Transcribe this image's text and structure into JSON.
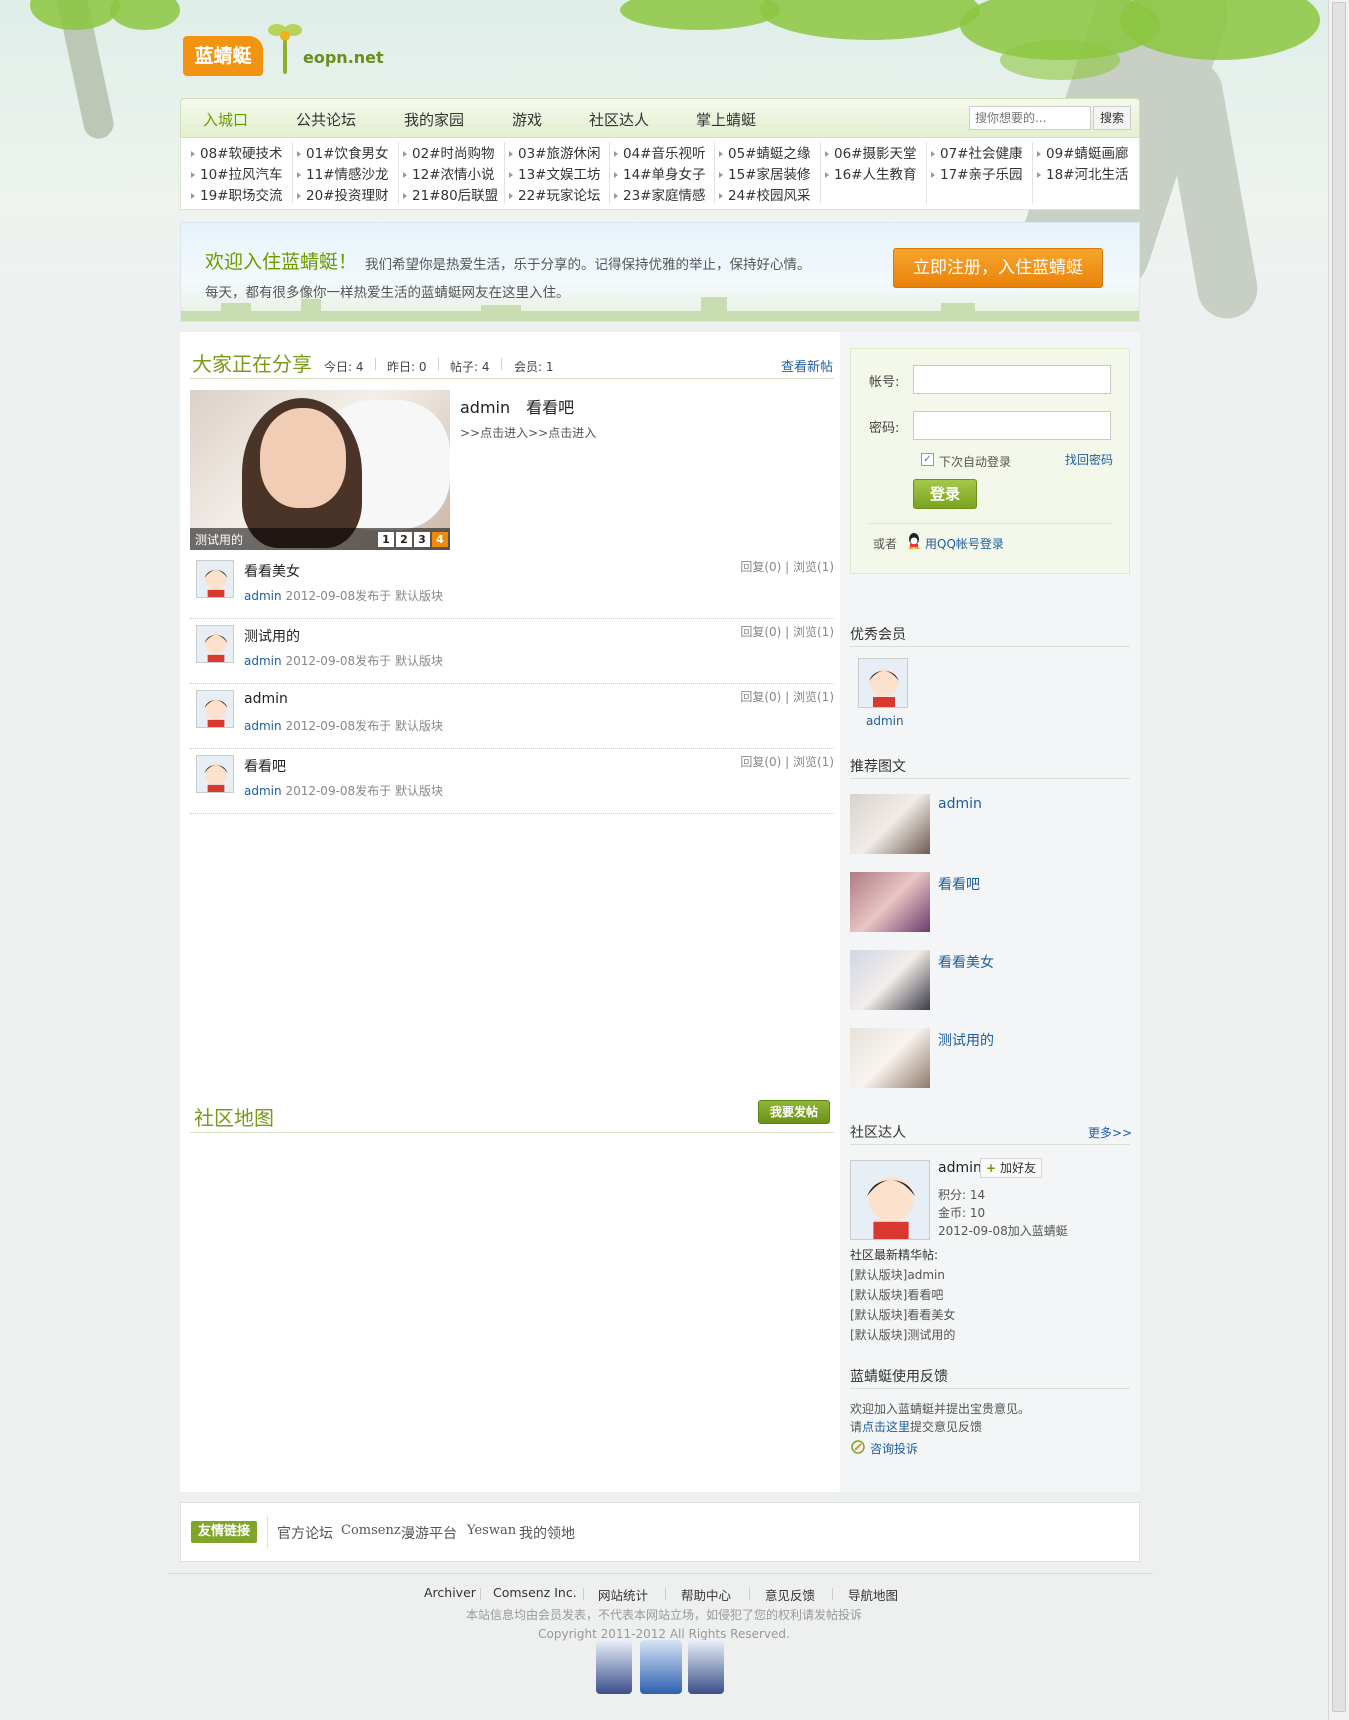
{
  "logo": {
    "brand": "蓝蜻蜓",
    "domain": "eopn.net"
  },
  "nav": {
    "items": [
      "入城口",
      "公共论坛",
      "我的家园",
      "游戏",
      "社区达人",
      "掌上蜻蜓"
    ],
    "search_placeholder": "搜你想要的...",
    "search_button": "搜索"
  },
  "forums": [
    [
      "08#软硬技术",
      "01#饮食男女",
      "02#时尚购物",
      "03#旅游休闲",
      "04#音乐视听",
      "05#蜻蜓之缘",
      "06#摄影天堂",
      "07#社会健康",
      "09#蜻蜓画廊"
    ],
    [
      "10#拉风汽车",
      "11#情感沙龙",
      "12#浓情小说",
      "13#文娱工坊",
      "14#单身女子",
      "15#家居装修",
      "16#人生教育",
      "17#亲子乐园",
      "18#河北生活"
    ],
    [
      "19#职场交流",
      "20#投资理财",
      "21#80后联盟",
      "22#玩家论坛",
      "23#家庭情感",
      "24#校园风采"
    ]
  ],
  "welcome": {
    "title": "欢迎入住蓝蜻蜓！",
    "desc1": "我们希望你是热爱生活，乐于分享的。记得保持优雅的举止，保持好心情。",
    "desc2": "每天，都有很多像你一样热爱生活的蓝蜻蜓网友在这里入住。",
    "register": "立即注册，入住蓝蜻蜓"
  },
  "sharing": {
    "title": "大家正在分享",
    "stats": [
      "今日: 4",
      "昨日: 0",
      "帖子: 4",
      "会员: 1"
    ],
    "new_link": "查看新帖",
    "slide_caption": "测试用的",
    "slide_numbers": [
      "1",
      "2",
      "3",
      "4"
    ],
    "featured_title": "admin　看看吧",
    "featured_sub": ">>点击进入>>点击进入"
  },
  "threads": [
    {
      "title": "看看美女",
      "author": "admin",
      "meta": "2012-09-08发布于 默认版块",
      "stats": "回复(0) | 浏览(1)"
    },
    {
      "title": "测试用的",
      "author": "admin",
      "meta": "2012-09-08发布于 默认版块",
      "stats": "回复(0) | 浏览(1)"
    },
    {
      "title": "admin",
      "author": "admin",
      "meta": "2012-09-08发布于 默认版块",
      "stats": "回复(0) | 浏览(1)"
    },
    {
      "title": "看看吧",
      "author": "admin",
      "meta": "2012-09-08发布于 默认版块",
      "stats": "回复(0) | 浏览(1)"
    }
  ],
  "map": {
    "title": "社区地图",
    "post_button": "我要发帖"
  },
  "login": {
    "account_label": "帐号:",
    "password_label": "密码:",
    "remember": "下次自动登录",
    "forgot": "找回密码",
    "submit": "登录",
    "or": "或者",
    "qq_login": "用QQ帐号登录"
  },
  "sidebar": {
    "members_title": "优秀会员",
    "member_name": "admin",
    "pics_title": "推荐图文",
    "pics": [
      "admin",
      "看看吧",
      "看看美女",
      "测试用的"
    ],
    "experts_title": "社区达人",
    "experts_more": "更多>>",
    "expert": {
      "name": "admin",
      "add_friend": "加好友",
      "points": "积分: 14",
      "coins": "金币: 10",
      "joined": "2012-09-08加入蓝蜻蜓"
    },
    "elite_title": "社区最新精华帖:",
    "elite": [
      "[默认版块]admin",
      "[默认版块]看看吧",
      "[默认版块]看看美女",
      "[默认版块]测试用的"
    ],
    "feedback_title": "蓝蜻蜓使用反馈",
    "feedback_line1": "欢迎加入蓝蜻蜓并提出宝贵意见。",
    "feedback_pre": "请",
    "feedback_link": "点击这里",
    "feedback_post": "提交意见反馈",
    "consult": "咨询投诉"
  },
  "links": {
    "badge": "友情链接",
    "items": [
      "官方论坛",
      "Comsenz",
      "漫游平台",
      "Yeswan",
      "我的领地"
    ]
  },
  "footer": {
    "nav": [
      "Archiver",
      "Comsenz Inc.",
      "网站统计",
      "帮助中心",
      "意见反馈",
      "导航地图"
    ],
    "notice": "本站信息均由会员发表，不代表本网站立场，如侵犯了您的权利请发帖投诉",
    "copyright": "Copyright 2011-2012 All Rights Reserved."
  },
  "colors": {
    "brand_green": "#7a9a1c",
    "link_blue": "#1e5d9e",
    "accent_orange": "#f29412"
  }
}
